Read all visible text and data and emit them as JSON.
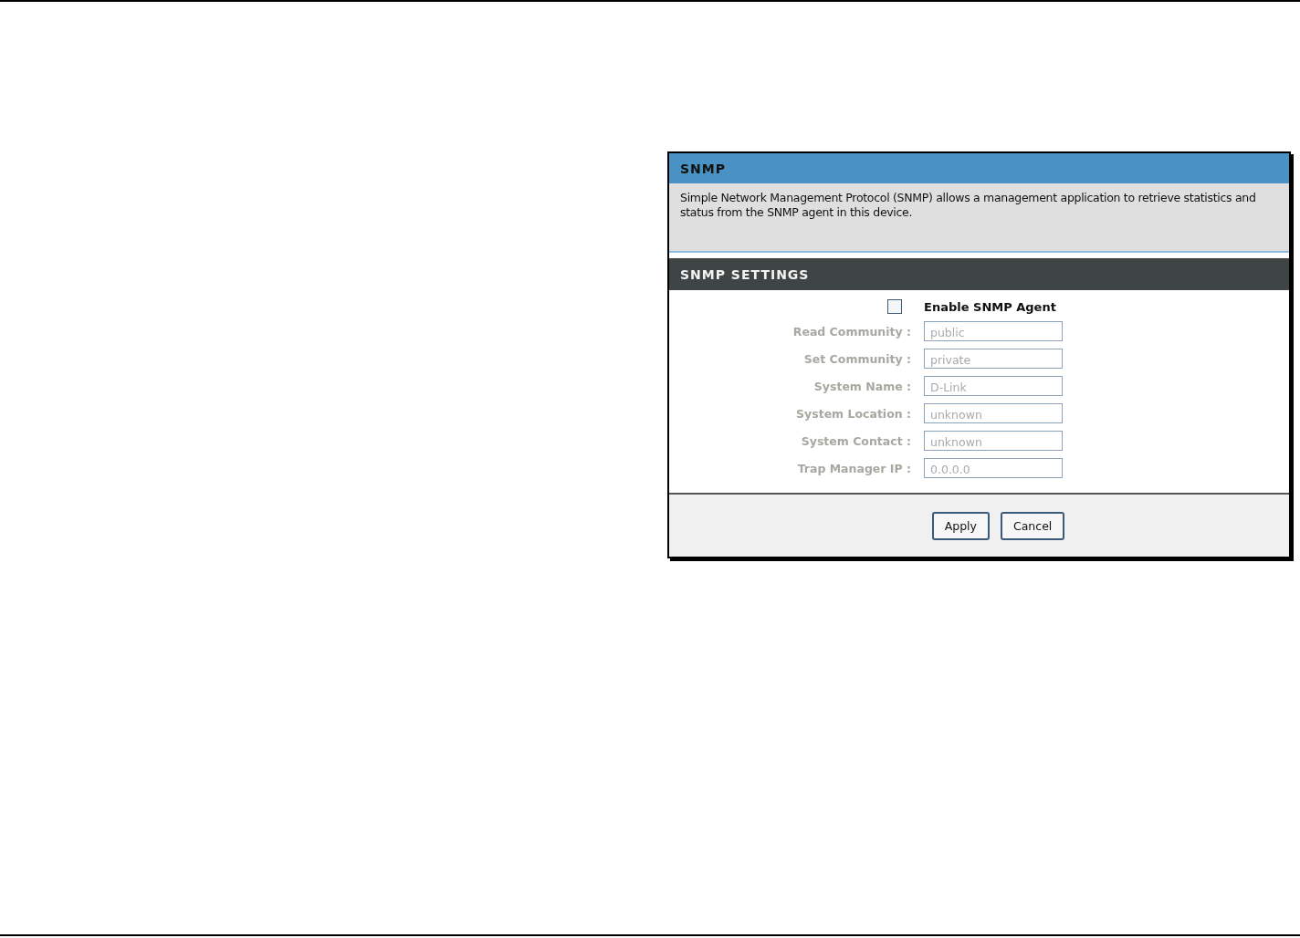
{
  "panel": {
    "title": "SNMP",
    "description": "Simple Network Management Protocol (SNMP) allows a management application to retrieve statistics and status from the SNMP agent in this device."
  },
  "settings": {
    "title": "SNMP SETTINGS",
    "enable": {
      "label": "Enable SNMP Agent",
      "checked": false
    },
    "fields": [
      {
        "label": "Read Community :",
        "value": "public",
        "disabled": true
      },
      {
        "label": "Set Community :",
        "value": "private",
        "disabled": true
      },
      {
        "label": "System Name :",
        "value": "D-Link",
        "disabled": true
      },
      {
        "label": "System Location :",
        "value": "unknown",
        "disabled": true
      },
      {
        "label": "System Contact :",
        "value": "unknown",
        "disabled": true
      },
      {
        "label": "Trap Manager IP :",
        "value": "0.0.0.0",
        "disabled": true
      }
    ]
  },
  "buttons": [
    {
      "label": "Apply"
    },
    {
      "label": "Cancel"
    }
  ]
}
